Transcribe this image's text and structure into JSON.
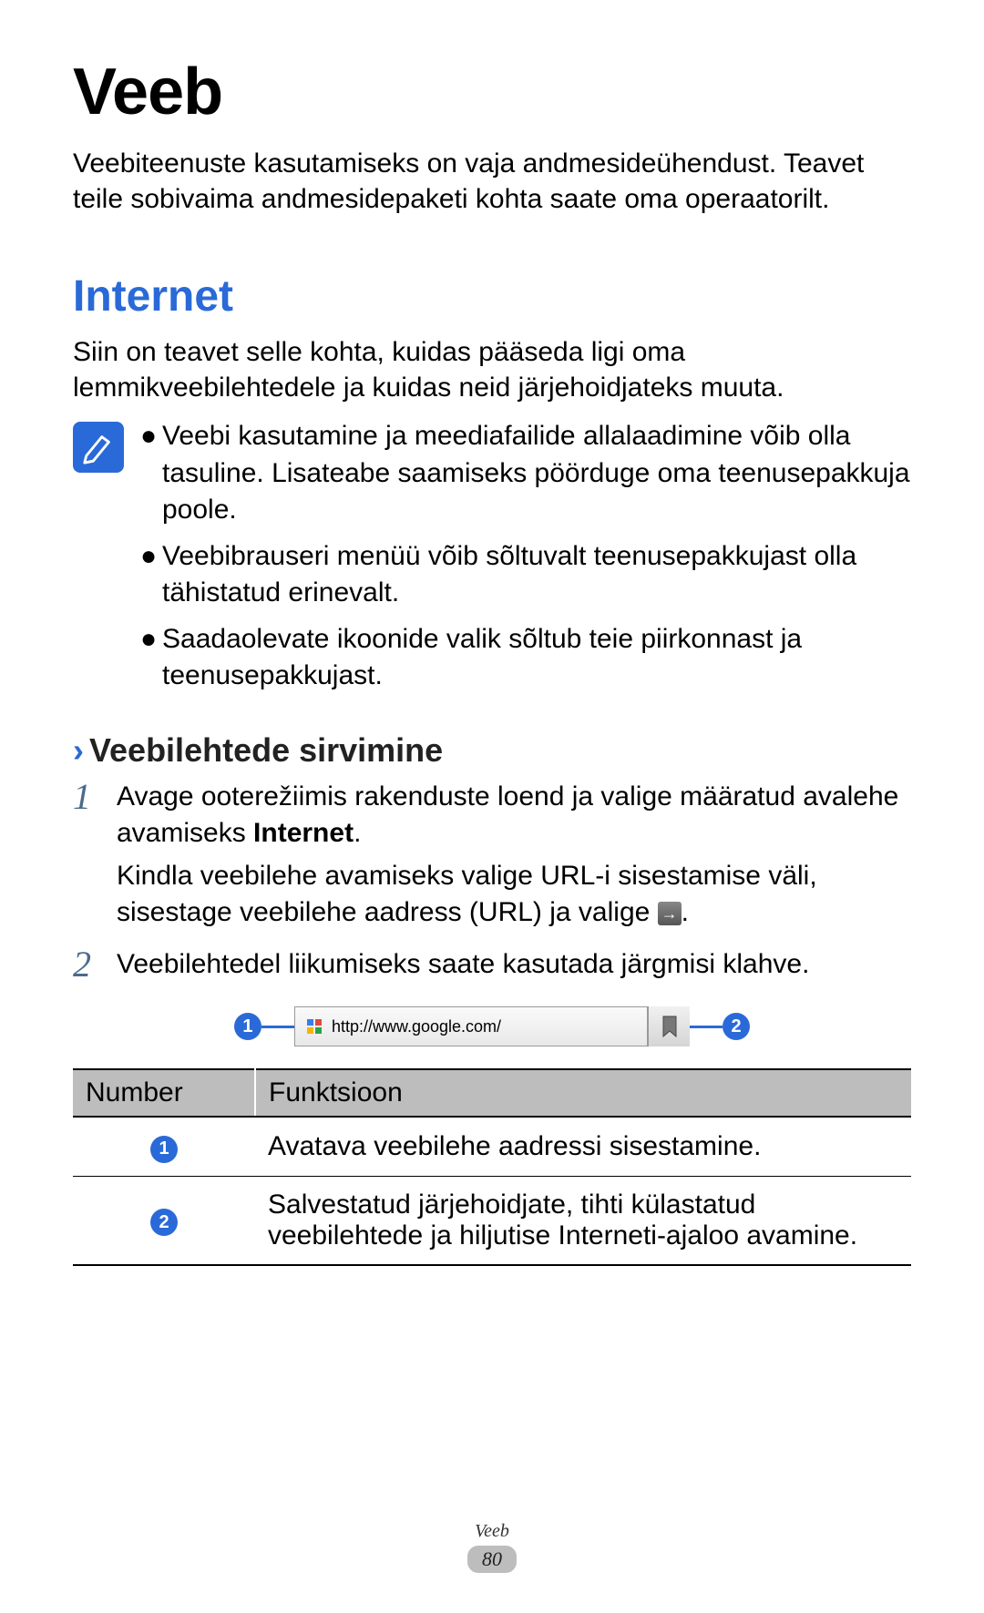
{
  "page": {
    "title": "Veeb",
    "intro": "Veebiteenuste kasutamiseks on vaja andmesideühendust. Teavet teile sobivaima andmesidepaketi kohta saate oma operaatorilt."
  },
  "section": {
    "heading": "Internet",
    "intro": "Siin on teavet selle kohta, kuidas pääseda ligi oma lemmikveebilehtedele ja kuidas neid järjehoidjateks muuta."
  },
  "notes": {
    "items": [
      "Veebi kasutamine ja meediafailide allalaadimine võib olla tasuline. Lisateabe saamiseks pöörduge oma teenusepakkuja poole.",
      "Veebibrauseri menüü võib sõltuvalt teenusepakkujast olla tähistatud erinevalt.",
      "Saadaolevate ikoonide valik sõltub teie piirkonnast ja teenusepakkujast."
    ],
    "bullet": "●"
  },
  "subsection": {
    "chevron": "›",
    "heading": "Veebilehtede sirvimine"
  },
  "steps": {
    "s1": {
      "num": "1",
      "line1_a": "Avage ooterežiimis rakenduste loend ja valige määratud avalehe avamiseks ",
      "line1_b": "Internet",
      "line1_c": ".",
      "line2_a": "Kindla veebilehe avamiseks valige URL-i sisestamise väli, sisestage veebilehe aadress (URL) ja valige ",
      "line2_c": "."
    },
    "s2": {
      "num": "2",
      "text": "Veebilehtedel liikumiseks saate kasutada järgmisi klahve."
    }
  },
  "figure": {
    "badge1": "1",
    "url": "http://www.google.com/",
    "badge2": "2"
  },
  "table": {
    "h1": "Number",
    "h2": "Funktsioon",
    "r1": {
      "b": "1",
      "f": "Avatava veebilehe aadressi sisestamine."
    },
    "r2": {
      "b": "2",
      "f": "Salvestatud järjehoidjate, tihti külastatud veebilehtede ja hiljutise Interneti-ajaloo avamine."
    }
  },
  "footer": {
    "title": "Veeb",
    "page": "80"
  },
  "icons": {
    "arrow": "→"
  }
}
